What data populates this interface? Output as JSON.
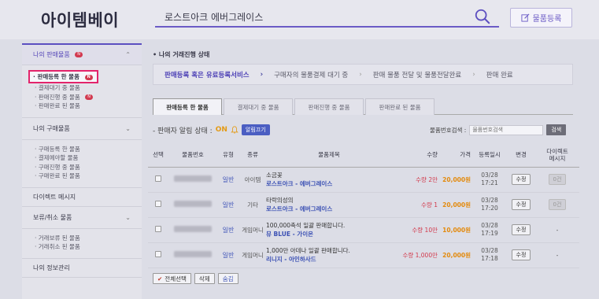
{
  "header": {
    "logo": "아이템베이",
    "search_value": "로스트아크 에버그레이스",
    "register_label": "물품등록"
  },
  "sidebar": {
    "sales": {
      "title": "나의 판매물품",
      "badge": "N",
      "items": [
        {
          "label": "· 판매등록 한 물품",
          "badge": "N"
        },
        {
          "label": "· 결제대기 중 물품"
        },
        {
          "label": "· 판매진행 중 물품",
          "badge": "N"
        },
        {
          "label": "· 판매완료 된 물품"
        }
      ]
    },
    "purchase": {
      "title": "나의 구매물품",
      "items": [
        {
          "label": "· 구매등록 한 물품"
        },
        {
          "label": "· 결제예야할 물품"
        },
        {
          "label": "· 구매진행 중 물품"
        },
        {
          "label": "· 구매완료 된 물품"
        }
      ]
    },
    "direct_message": "다이렉트 메시지",
    "hold": {
      "title": "보류/취소 물품",
      "items": [
        {
          "label": "· 거래보류 된 물품"
        },
        {
          "label": "· 거래취소 된 물품"
        }
      ]
    },
    "info": "나의 정보관리"
  },
  "main": {
    "section_title": "• 나의 거래진행 상태",
    "steps": [
      "판매등록 혹은 유료등록서비스",
      "구매자의 물품결제 대기 중",
      "판매 물품 전달 및 물품전달완료",
      "판매 완료"
    ],
    "tabs": [
      "판매등록 한 물품",
      "결제대기 중 물품",
      "판매진행 중 물품",
      "판매완료 된 물품"
    ],
    "alarm_label": "- 판매자 알림 상태 :",
    "alarm_state": "ON",
    "alarm_off_button": "알림끄기",
    "search_label": "물품번호검색 :",
    "search_placeholder": "물품번호검색",
    "search_button": "검색",
    "columns": [
      "선택",
      "물품번호",
      "유형",
      "종류",
      "물품제목",
      "수량",
      "가격",
      "등록일시",
      "변경",
      "다이렉트\n메시지"
    ],
    "rows": [
      {
        "type": "일반",
        "kind": "아이템",
        "title": "소금꽃",
        "sub": "로스트아크 - 에버그레이스",
        "qty": "수량 2만",
        "price": "20,000원",
        "date1": "03/28",
        "date2": "17:21",
        "change": "수정",
        "dm": "0건"
      },
      {
        "type": "일반",
        "kind": "기타",
        "title": "타락의성의",
        "sub": "로스트아크 - 에버그레이스",
        "qty": "수량 1",
        "price": "20,000원",
        "date1": "03/28",
        "date2": "17:20",
        "change": "수정",
        "dm": "0건"
      },
      {
        "type": "일반",
        "kind": "게임머니",
        "title": "100,000축석 일괄 판매합니다.",
        "sub": "뮤 BLUE - 가이온",
        "qty": "수량 10만",
        "price": "10,000원",
        "date1": "03/28",
        "date2": "17:19",
        "change": "수정",
        "dm": "-"
      },
      {
        "type": "일반",
        "kind": "게임머니",
        "title": "1,000만 아데나 일괄 판매합니다.",
        "sub": "리니지 - 아인하사드",
        "qty": "수량 1,000만",
        "price": "20,000원",
        "date1": "03/28",
        "date2": "17:18",
        "change": "수정",
        "dm": "-"
      }
    ],
    "bottom_buttons": [
      "전체선택",
      "삭제",
      "숨김"
    ]
  }
}
